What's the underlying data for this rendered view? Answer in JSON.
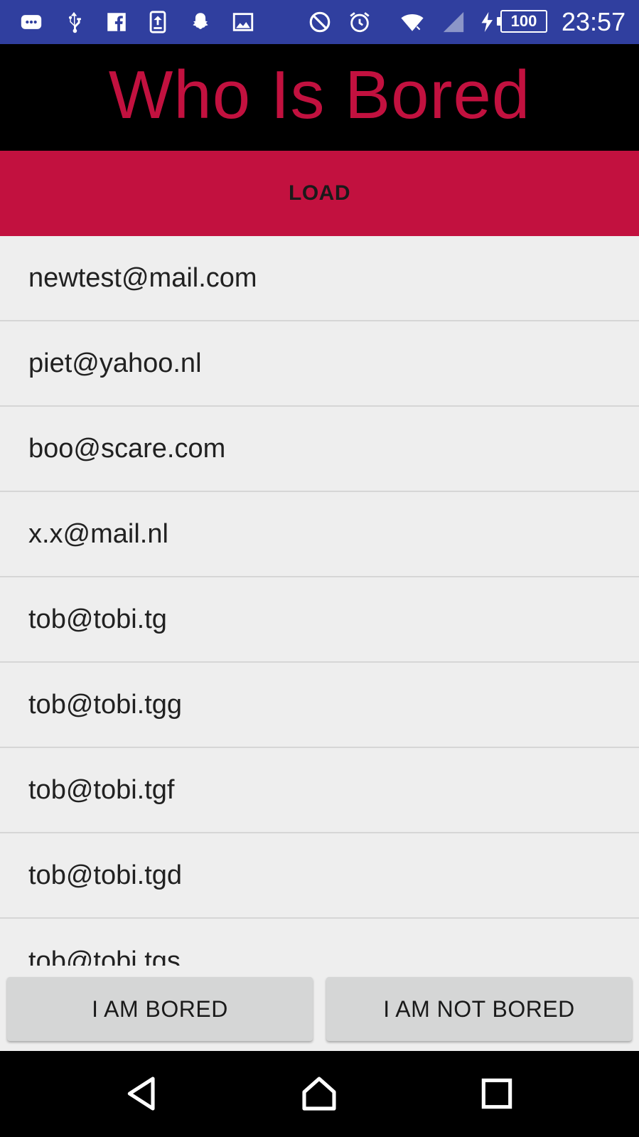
{
  "status_bar": {
    "battery": "100",
    "time": "23:57",
    "icons_left": [
      "chat-icon",
      "usb-icon",
      "facebook-icon",
      "upload-icon",
      "snapchat-icon",
      "image-icon"
    ],
    "icons_right": [
      "do-not-disturb-icon",
      "alarm-icon",
      "wifi-icon",
      "signal-icon",
      "charging-icon"
    ]
  },
  "app": {
    "title": "Who Is Bored",
    "accent_color": "#c2113f",
    "load_label": "LOAD"
  },
  "emails": [
    "newtest@mail.com",
    "piet@yahoo.nl",
    "boo@scare.com",
    "x.x@mail.nl",
    "tob@tobi.tg",
    "tob@tobi.tgg",
    "tob@tobi.tgf",
    "tob@tobi.tgd",
    "tob@tobi.tgs"
  ],
  "actions": {
    "bored_label": "I AM BORED",
    "not_bored_label": "I AM NOT BORED"
  },
  "nav": [
    "back-icon",
    "home-icon",
    "recents-icon"
  ]
}
